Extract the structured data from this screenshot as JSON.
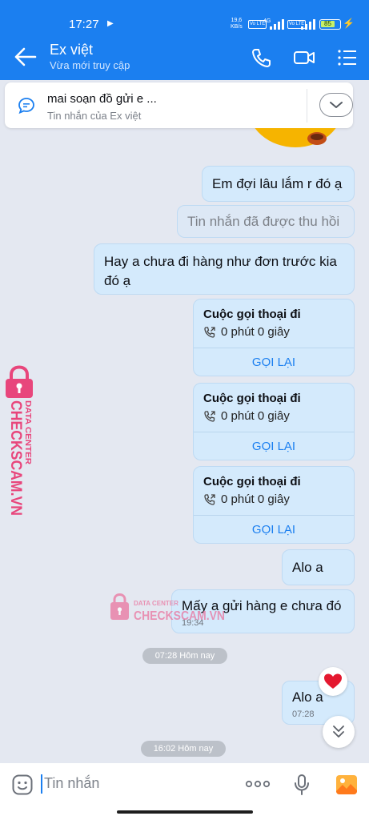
{
  "status_bar": {
    "time": "17:27",
    "network_speed": "19,6",
    "network_unit": "KB/s",
    "volte_1": "Vo LTE",
    "net_gen": "4G",
    "volte_2": "Vo LTE",
    "battery": "85"
  },
  "header": {
    "title": "Ex việt",
    "subtitle": "Vừa mới truy cập"
  },
  "pinned": {
    "message": "mai soạn đồ gửi e ...",
    "source": "Tin nhắn của Ex việt"
  },
  "messages": {
    "m1": "Em đợi lâu lắm r đó ạ",
    "m2": "Tin nhắn đã được thu hồi",
    "m3": "Hay a chưa đi hàng như đơn trước kia đó ạ",
    "m4": "Alo a",
    "m5": "Mấy a gửi hàng e chưa đó",
    "m5_time": "19:34",
    "m6": "Alo a",
    "m6_time": "07:28"
  },
  "calls": [
    {
      "title": "Cuộc gọi thoại đi",
      "duration": "0 phút 0 giây",
      "action": "GỌI LẠI"
    },
    {
      "title": "Cuộc gọi thoại đi",
      "duration": "0 phút 0 giây",
      "action": "GỌI LẠI"
    },
    {
      "title": "Cuộc gọi thoại đi",
      "duration": "0 phút 0 giây",
      "action": "GỌI LẠI"
    }
  ],
  "separators": {
    "s1": "07:28 Hôm nay",
    "s2": "16:02 Hôm nay"
  },
  "watermark": {
    "brand": "CHECKSCAM.VN",
    "tagline": "DATA CENTER"
  },
  "input": {
    "placeholder": "Tin nhắn"
  },
  "colors": {
    "accent": "#1b7ff0",
    "bubble": "#d4eafc",
    "background": "#e4e8f1",
    "watermark": "#e8467c"
  }
}
